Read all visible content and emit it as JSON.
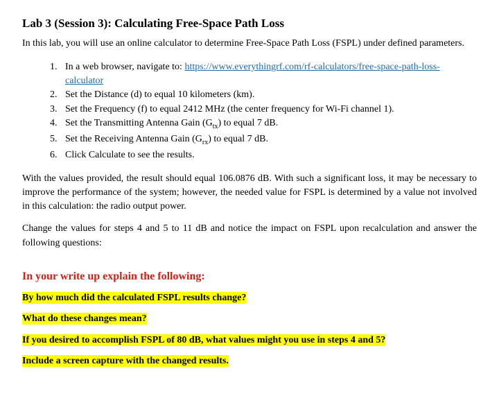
{
  "title": "Lab 3 (Session 3): Calculating Free-Space Path Loss",
  "intro": "In this lab, you will use an online calculator to determine Free-Space Path Loss (FSPL) under defined parameters.",
  "steps": {
    "s1_pre": "In a web browser, navigate to: ",
    "s1_link": "https://www.everythingrf.com/rf-calculators/free-space-path-loss-calculator",
    "s2": "Set the Distance (d) to equal 10 kilometers (km).",
    "s3": "Set the Frequency (f) to equal 2412 MHz (the center frequency for Wi-Fi channel 1).",
    "s4_a": "Set the Transmitting Antenna Gain (G",
    "s4_sub": "tx",
    "s4_b": ") to equal 7 dB.",
    "s5_a": "Set the Receiving Antenna Gain (G",
    "s5_sub": "rx",
    "s5_b": ") to equal 7 dB.",
    "s6": "Click Calculate to see the results."
  },
  "para1": "With the values provided, the result should equal 106.0876 dB. With such a significant loss, it may be necessary to improve the performance of the system; however, the needed value for FSPL is determined by a value not involved in this calculation: the radio output power.",
  "para2": "Change the values for steps 4 and 5 to 11 dB and notice the impact on FSPL upon recalculation and answer the following questions:",
  "writeup_heading": "In your write up explain the following:",
  "q1": "By how much did the calculated FSPL results change?",
  "q2": "What do these changes mean?",
  "q3": "If you desired to accomplish FSPL of 80 dB, what values might you use in steps 4 and 5?",
  "q4": "Include a screen capture with the changed results."
}
